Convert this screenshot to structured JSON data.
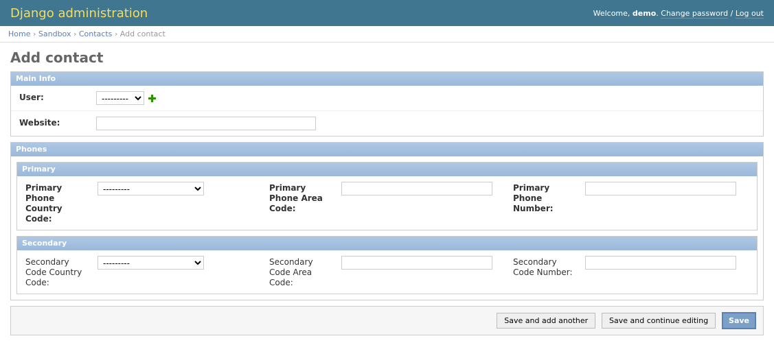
{
  "header": {
    "branding": "Django administration",
    "welcome": "Welcome,",
    "username": "demo",
    "change_password": "Change password",
    "logout": "Log out"
  },
  "breadcrumbs": {
    "home": "Home",
    "sandbox": "Sandbox",
    "contacts": "Contacts",
    "current": "Add contact"
  },
  "page_title": "Add contact",
  "fieldsets": {
    "main_info": {
      "title": "Main Info",
      "user_label": "User:",
      "user_selected": "---------",
      "website_label": "Website:",
      "website_value": ""
    },
    "phones": {
      "title": "Phones",
      "primary": {
        "title": "Primary",
        "country_label": "Primary Phone Country Code:",
        "country_selected": "---------",
        "area_label": "Primary Phone Area Code:",
        "area_value": "",
        "number_label": "Primary Phone Number:",
        "number_value": ""
      },
      "secondary": {
        "title": "Secondary",
        "country_label": "Secondary Code Country Code:",
        "country_selected": "---------",
        "area_label": "Secondary Code Area Code:",
        "area_value": "",
        "number_label": "Secondary Code Number:",
        "number_value": ""
      }
    }
  },
  "buttons": {
    "save_add_another": "Save and add another",
    "save_continue": "Save and continue editing",
    "save": "Save"
  }
}
